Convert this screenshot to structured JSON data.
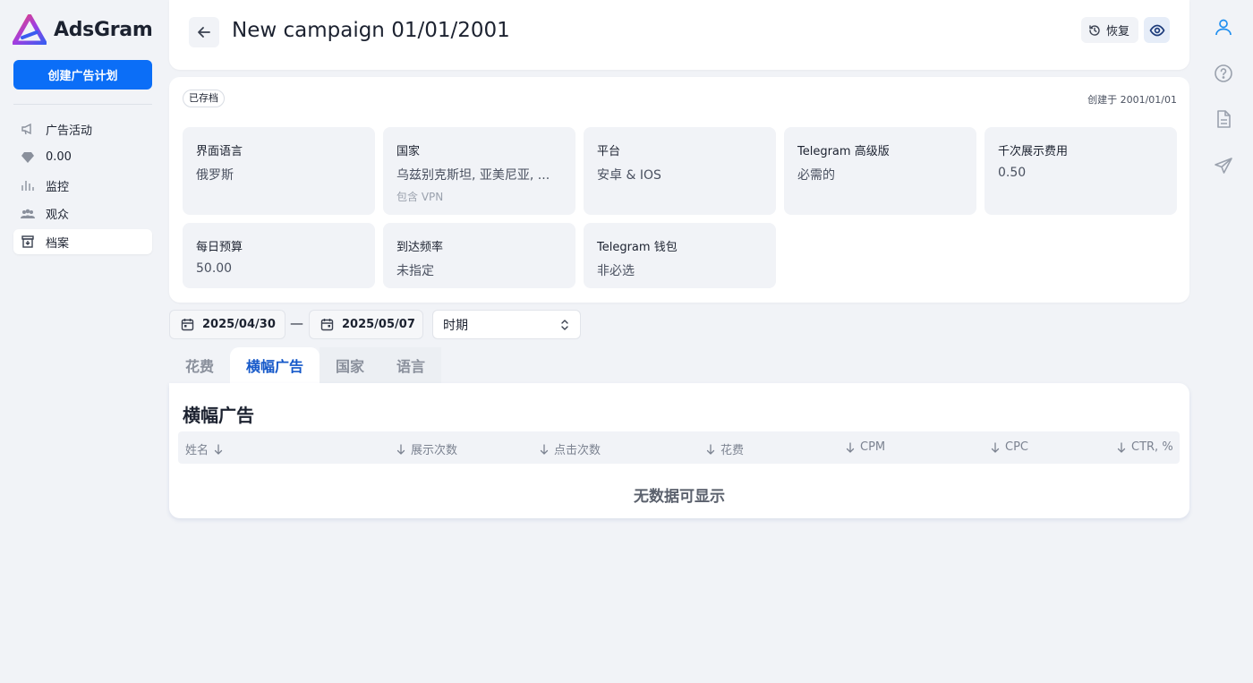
{
  "brand": {
    "name": "AdsGram",
    "accent": "#0b6ef7"
  },
  "sidebar": {
    "create_label": "创建广告计划",
    "items": [
      {
        "label": "广告活动",
        "icon": "megaphone-icon"
      },
      {
        "label": "0.00",
        "icon": "diamond-icon"
      },
      {
        "label": "监控",
        "icon": "bar-chart-icon"
      },
      {
        "label": "观众",
        "icon": "users-icon"
      },
      {
        "label": "档案",
        "icon": "archive-icon"
      }
    ]
  },
  "header": {
    "title": "New campaign 01/01/2001",
    "restore_label": "恢复"
  },
  "info": {
    "badge": "已存档",
    "created": "创建于 2001/01/01",
    "tiles": [
      {
        "label": "界面语言",
        "value": "俄罗斯"
      },
      {
        "label": "国家",
        "value": "乌兹别克斯坦, 亚美尼亚, ...",
        "sub": "包含 VPN"
      },
      {
        "label": "平台",
        "value": "安卓 & IOS"
      },
      {
        "label": "Telegram 高级版",
        "value": "必需的"
      },
      {
        "label": "千次展示费用",
        "value": "0.50"
      },
      {
        "label": "每日预算",
        "value": "50.00"
      },
      {
        "label": "到达频率",
        "value": "未指定"
      },
      {
        "label": "Telegram 钱包",
        "value": "非必选"
      }
    ]
  },
  "filters": {
    "date_from": "2025/04/30",
    "date_to": "2025/05/07",
    "period_label": "时期"
  },
  "tabs": [
    {
      "label": "花费"
    },
    {
      "label": "横幅广告"
    },
    {
      "label": "国家"
    },
    {
      "label": "语言"
    }
  ],
  "table": {
    "title": "横幅广告",
    "columns": [
      "姓名",
      "展示次数",
      "点击次数",
      "花费",
      "CPM",
      "CPC",
      "CTR, %"
    ],
    "empty_text": "无数据可显示"
  }
}
